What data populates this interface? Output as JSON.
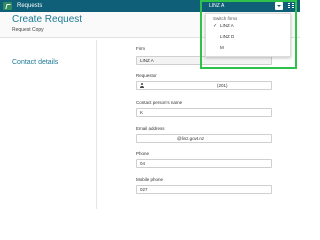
{
  "topbar": {
    "app_title": "Requests",
    "firm_selected": "LINZ A",
    "colors": {
      "bar": "#0e5f77",
      "accent": "#1b7a97",
      "highlight": "#2fc24a"
    }
  },
  "header": {
    "title": "Create Request",
    "subtitle": "Request Copy"
  },
  "section_title": "Contact details",
  "fields": {
    "firm": {
      "label": "Firm",
      "value": "LINZ A"
    },
    "requestor": {
      "label": "Requestor",
      "value": "(201)"
    },
    "contact": {
      "label": "Contact person's name",
      "value": "K"
    },
    "email": {
      "label": "Email address",
      "value": "@linz.govt.nz"
    },
    "phone": {
      "label": "Phone",
      "value": "04"
    },
    "mobile": {
      "label": "Mobile phone",
      "value": "027"
    }
  },
  "dropdown": {
    "header": "Switch firms",
    "items": [
      {
        "label": "LINZ A",
        "selected": true
      },
      {
        "label": "LINZ D",
        "selected": false
      },
      {
        "label": "M",
        "selected": false
      }
    ]
  }
}
